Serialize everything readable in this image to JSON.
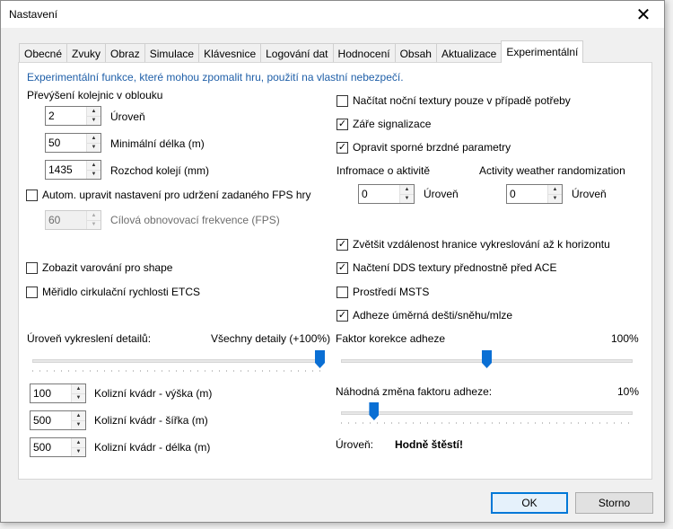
{
  "window": {
    "title": "Nastavení",
    "close_glyph": "✕"
  },
  "tabs": [
    {
      "label": "Obecné"
    },
    {
      "label": "Zvuky"
    },
    {
      "label": "Obraz"
    },
    {
      "label": "Simulace"
    },
    {
      "label": "Klávesnice"
    },
    {
      "label": "Logování dat"
    },
    {
      "label": "Hodnocení"
    },
    {
      "label": "Obsah"
    },
    {
      "label": "Aktualizace"
    },
    {
      "label": "Experimentální",
      "active": true
    }
  ],
  "left": {
    "info_text": "Experimentální funkce, které mohou zpomalit hru, použití na vlastní nebezpečí.",
    "superelevation_label": "Převýšení kolejnic v oblouku",
    "level_value": "2",
    "level_label": "Úroveň",
    "min_length_value": "50",
    "min_length_label": "Minimální délka (m)",
    "gauge_value": "1435",
    "gauge_label": "Rozchod kolejí (mm)",
    "auto_fps_label": "Autom. upravit nastavení pro udržení zadaného FPS hry",
    "auto_fps_checked": false,
    "target_fps_value": "60",
    "target_fps_label": "Cílová obnovovací frekvence (FPS)",
    "shape_warnings_label": "Zobazit varování pro shape",
    "shape_warnings_checked": false,
    "etcs_label": "Měřidlo cirkulační rychlosti ETCS",
    "etcs_checked": false,
    "lod_label": "Úroveň vykreslení detailů:",
    "lod_value_text": "Všechny detaily (+100%)",
    "lod_fraction": 1.0,
    "collision_height_value": "100",
    "collision_height_label": "Kolizní kvádr - výška (m)",
    "collision_width_value": "500",
    "collision_width_label": "Kolizní kvádr - šířka (m)",
    "collision_length_value": "500",
    "collision_length_label": "Kolizní kvádr - délka (m)"
  },
  "right": {
    "night_textures_label": "Načítat noční textury pouze v případě potřeby",
    "night_textures_checked": false,
    "signal_glow_label": "Záře signalizace",
    "signal_glow_checked": true,
    "brake_params_label": "Opravit sporné brzdné parametry",
    "brake_params_checked": true,
    "activity_info_label": "Infromace o aktivitě",
    "activity_info_value": "0",
    "activity_info_level_label": "Úroveň",
    "weather_label": "Activity weather randomization",
    "weather_value": "0",
    "weather_level_label": "Úroveň",
    "horizon_label": "Zvětšit vzdálenost hranice vykreslování až k horizontu",
    "horizon_checked": true,
    "dds_label": "Načtení DDS textury přednostně před ACE",
    "dds_checked": true,
    "msts_env_label": "Prostředí MSTS",
    "msts_env_checked": false,
    "adhesion_weather_label": "Adheze úměrná dešti/sněhu/mlze",
    "adhesion_weather_checked": true,
    "adhesion_factor_label": "Faktor korekce adheze",
    "adhesion_factor_value_text": "100%",
    "adhesion_factor_fraction": 0.5,
    "random_adhesion_label": "Náhodná změna faktoru adheze:",
    "random_adhesion_value_text": "10%",
    "random_adhesion_fraction": 0.1,
    "level_label": "Úroveň:",
    "level_value": "Hodně štěstí!"
  },
  "buttons": {
    "ok": "OK",
    "cancel": "Storno"
  },
  "glyphs": {
    "check": "✓",
    "up": "▲",
    "down": "▼"
  }
}
